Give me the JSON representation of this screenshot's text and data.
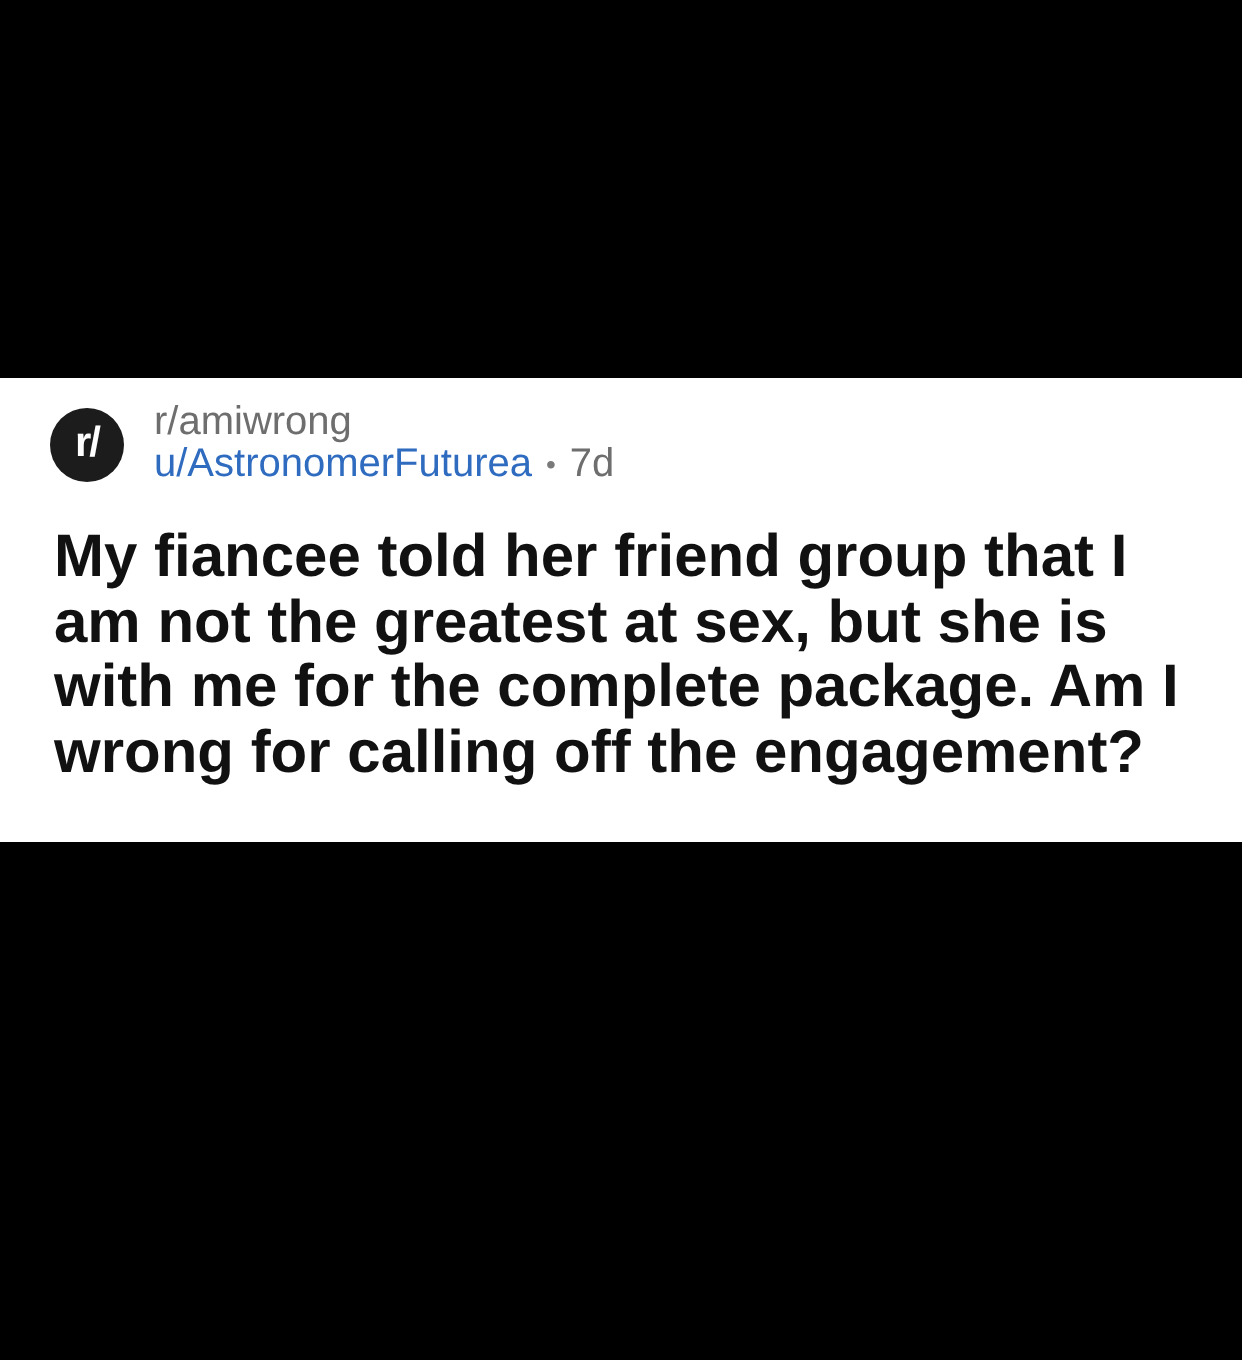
{
  "post": {
    "avatar_text": "r/",
    "subreddit": "r/amiwrong",
    "author": "u/AstronomerFuturea",
    "separator": "•",
    "age": "7d",
    "title": "My fiancee told her friend group that I am not the greatest at sex, but she is with me for the complete package. Am I wrong for calling off the engagement?"
  }
}
